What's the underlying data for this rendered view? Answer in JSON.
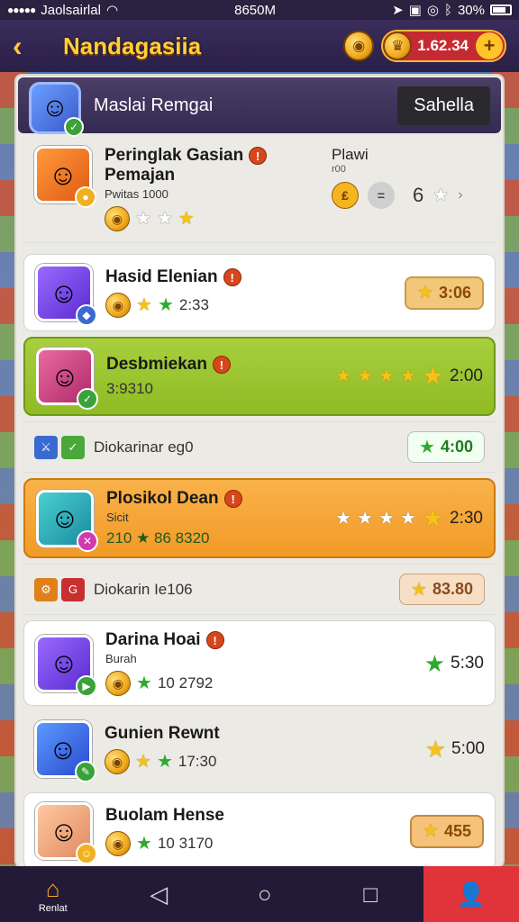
{
  "status": {
    "carrier": "Jaolsairlal",
    "time": "8650M",
    "battery": "30%"
  },
  "header": {
    "title": "Nandagasiia",
    "currency": "1.62.34"
  },
  "profile": {
    "name": "Maslai Remgai",
    "tab": "Sahella"
  },
  "featured": {
    "name_line1": "Peringlak Gasian",
    "name_line2": "Pemajan",
    "sub": "Pwitas 1000",
    "vs_label": "Plawi",
    "vs_sub": "r00",
    "score": "6"
  },
  "rows": [
    {
      "name": "Hasid Elenian",
      "meta": "2:33",
      "reward": "3:06",
      "style": "white"
    },
    {
      "name": "Desbmiekan",
      "meta": "3:9310",
      "reward": "2:00",
      "style": "green"
    },
    {
      "sub_label": "Diokarinar eg0",
      "reward": "4:00",
      "style": "subrow"
    },
    {
      "name": "Plosikol Dean",
      "sub": "Sicit",
      "meta": "210 ★ 86 8320",
      "reward": "2:30",
      "style": "orange"
    },
    {
      "sub_label": "Diokarin Ie106",
      "reward": "83.80",
      "style": "subrow"
    },
    {
      "name": "Darina Hoai",
      "sub": "Burah",
      "meta": "10 2792",
      "reward": "5:30",
      "style": "white"
    },
    {
      "name": "Gunien Rewnt",
      "meta": "17:30",
      "reward": "5:00",
      "style": "plain"
    },
    {
      "name": "Buolam Hense",
      "meta": "10 3170",
      "reward": "455",
      "style": "white"
    }
  ],
  "nav": {
    "home_label": "Renlat"
  },
  "colors": {
    "accent_gold": "#ffcf3a",
    "header_bg": "#2a1f47",
    "green_row": "#a8cf3e",
    "orange_row": "#f9b24a",
    "profile_red": "#e0333a"
  }
}
